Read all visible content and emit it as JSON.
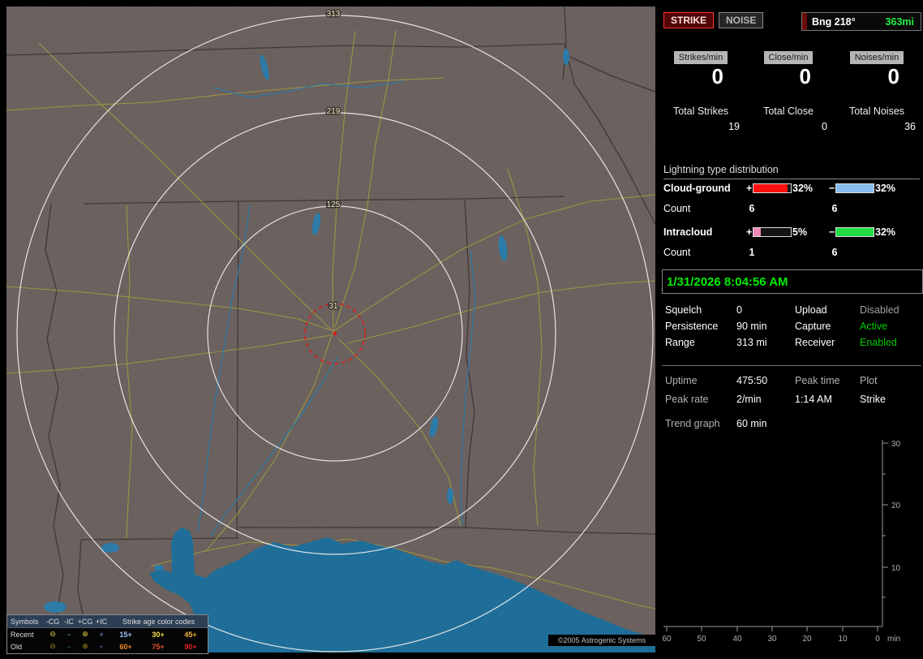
{
  "map": {
    "ring_labels": [
      "313",
      "219",
      "125",
      "31"
    ],
    "copyright": "©2005 Astrogenic Systems",
    "legend": {
      "symbols_header": "Symbols",
      "col_headers": [
        "-CG",
        "-IC",
        "+CG",
        "+IC"
      ],
      "age_header": "Strike age color codes",
      "rows": [
        {
          "label": "Recent",
          "symbols": [
            {
              "glyph": "⊖",
              "color": "#e8d44a"
            },
            {
              "glyph": "−",
              "color": "#55cccc"
            },
            {
              "glyph": "⊕",
              "color": "#e8d44a"
            },
            {
              "glyph": "+",
              "color": "#7a9aff"
            }
          ],
          "ages": [
            {
              "text": "15+",
              "color": "#9fc3ff"
            },
            {
              "text": "30+",
              "color": "#f0e24a"
            },
            {
              "text": "45+",
              "color": "#f0b43c"
            }
          ]
        },
        {
          "label": "Old",
          "symbols": [
            {
              "glyph": "⊖",
              "color": "#a08820"
            },
            {
              "glyph": "−",
              "color": "#3a8888"
            },
            {
              "glyph": "⊕",
              "color": "#a08820"
            },
            {
              "glyph": "+",
              "color": "#5a6aaa"
            }
          ],
          "ages": [
            {
              "text": "60+",
              "color": "#f08a2a"
            },
            {
              "text": "75+",
              "color": "#e8542a"
            },
            {
              "text": "90+",
              "color": "#e82222"
            }
          ]
        }
      ]
    }
  },
  "panel": {
    "strike_button": "STRIKE",
    "noise_button": "NOISE",
    "bearing_label": "Bng 218°",
    "bearing_value": "363mi",
    "bearing_value_color": "#22ee44",
    "counters": [
      {
        "label": "Strikes/min",
        "value": "0",
        "total_label": "Total Strikes",
        "total": "19"
      },
      {
        "label": "Close/min",
        "value": "0",
        "total_label": "Total Close",
        "total": "0"
      },
      {
        "label": "Noises/min",
        "value": "0",
        "total_label": "Total Noises",
        "total": "36"
      }
    ],
    "distribution": {
      "title": "Lightning type distribution",
      "rows": [
        {
          "label": "Cloud-ground",
          "plus_sign": "+",
          "minus_sign": "−",
          "plus_pct": "32%",
          "minus_pct": "32%",
          "count_label": "Count",
          "plus_count": "6",
          "minus_count": "6",
          "plus_color": "#ff1111",
          "minus_color": "#88bbee",
          "plus_fill": "92%",
          "minus_fill": "100%"
        },
        {
          "label": "Intracloud",
          "plus_sign": "+",
          "minus_sign": "−",
          "plus_pct": "5%",
          "minus_pct": "32%",
          "count_label": "Count",
          "plus_count": "1",
          "minus_count": "6",
          "plus_color": "#ee88bb",
          "minus_color": "#22dd44",
          "plus_fill": "20%",
          "minus_fill": "100%"
        }
      ]
    },
    "datetime": "1/31/2026 8:04:56 AM",
    "datetime_color": "#00ee00",
    "settings": [
      {
        "label": "Squelch",
        "value": "0",
        "value_color": "#ffffff",
        "label2": "Upload",
        "value2": "Disabled",
        "value2_color": "#a0a0a0"
      },
      {
        "label": "Persistence",
        "value": "90 min",
        "value_color": "#ffffff",
        "label2": "Capture",
        "value2": "Active",
        "value2_color": "#00cc00"
      },
      {
        "label": "Range",
        "value": "313 mi",
        "value_color": "#ffffff",
        "label2": "Receiver",
        "value2": "Enabled",
        "value2_color": "#00cc00"
      }
    ],
    "stats": {
      "uptime_label": "Uptime",
      "uptime_value": "475:50",
      "peak_time_label": "Peak time",
      "plot_label": "Plot",
      "peak_rate_label": "Peak rate",
      "peak_rate_value": "2/min",
      "peak_time_value": "1:14 AM",
      "plot_value": "Strike",
      "trend_label": "Trend graph",
      "trend_value": "60 min"
    },
    "trend_graph": {
      "y_ticks": [
        "30",
        "20",
        "10"
      ],
      "x_ticks": [
        "60",
        "50",
        "40",
        "30",
        "20",
        "10",
        "0"
      ],
      "x_unit": "min"
    }
  }
}
